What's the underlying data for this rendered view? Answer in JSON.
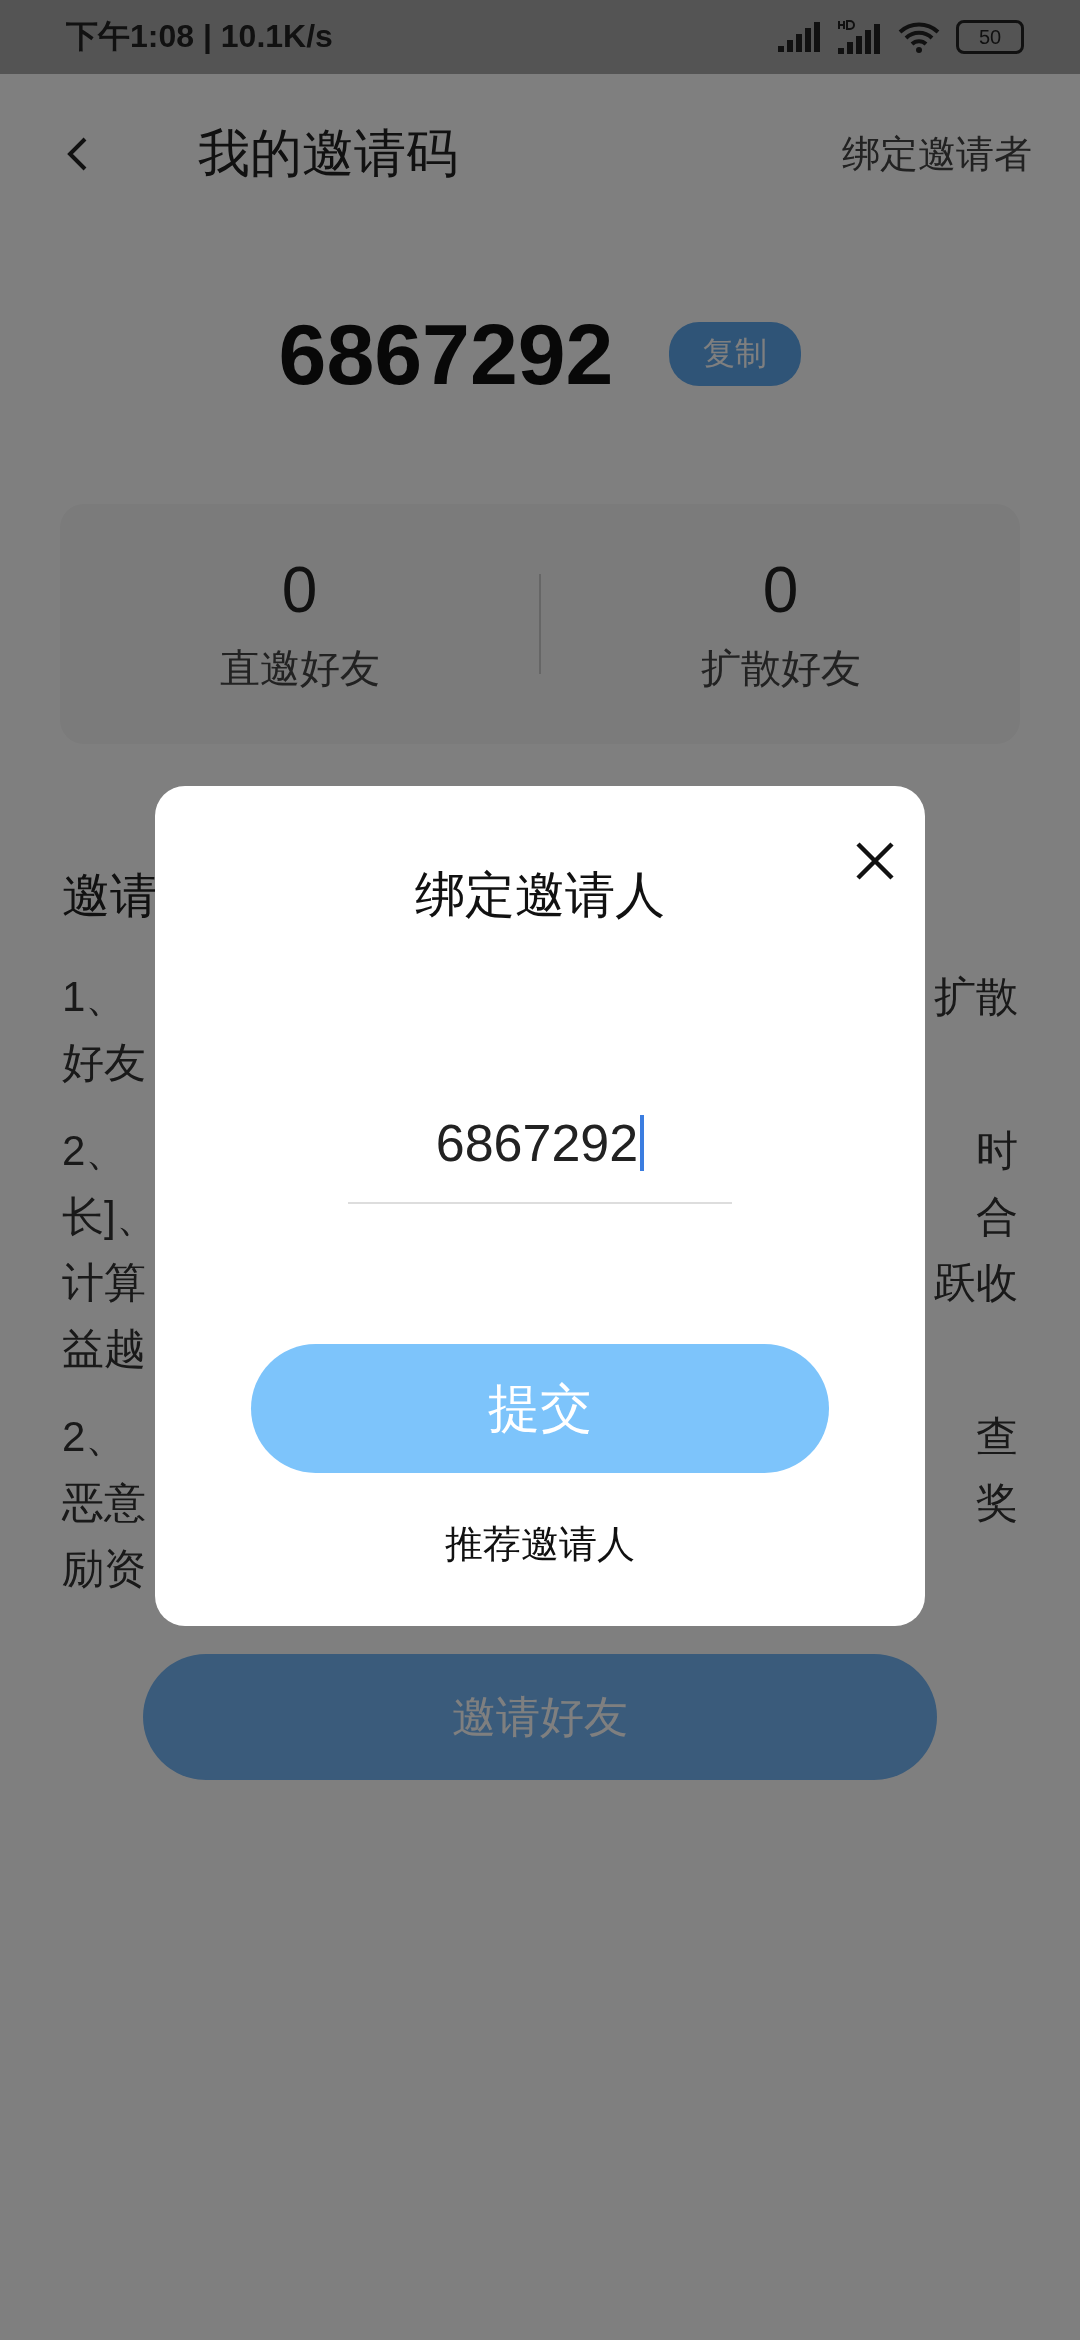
{
  "status_bar": {
    "time": "下午1:08 | 10.1K/s",
    "battery": "50"
  },
  "header": {
    "title": "我的邀请码",
    "action": "绑定邀请者"
  },
  "invite_code": {
    "code": "6867292",
    "copy_button": "复制"
  },
  "stats": [
    {
      "value": "0",
      "label": "直邀好友"
    },
    {
      "value": "0",
      "label": "扩散好友"
    }
  ],
  "rules": {
    "heading": "邀请",
    "paragraphs": [
      [
        {
          "left": "1、",
          "right": "扩散"
        },
        {
          "left": "好友"
        }
      ],
      [
        {
          "left": "2、",
          "right": "时"
        },
        {
          "left": "长]、",
          "right": "合"
        },
        {
          "left": "计算",
          "right": "跃收"
        },
        {
          "left": "益越"
        }
      ],
      [
        {
          "left": "2、",
          "right": "查"
        },
        {
          "left": "恶意",
          "right": "奖"
        },
        {
          "left": "励资"
        }
      ]
    ]
  },
  "invite_button": "邀请好友",
  "dialog": {
    "title": "绑定邀请人",
    "input": {
      "value": "6867292",
      "focused": true
    },
    "submit": "提交",
    "link": "推荐邀请人"
  }
}
